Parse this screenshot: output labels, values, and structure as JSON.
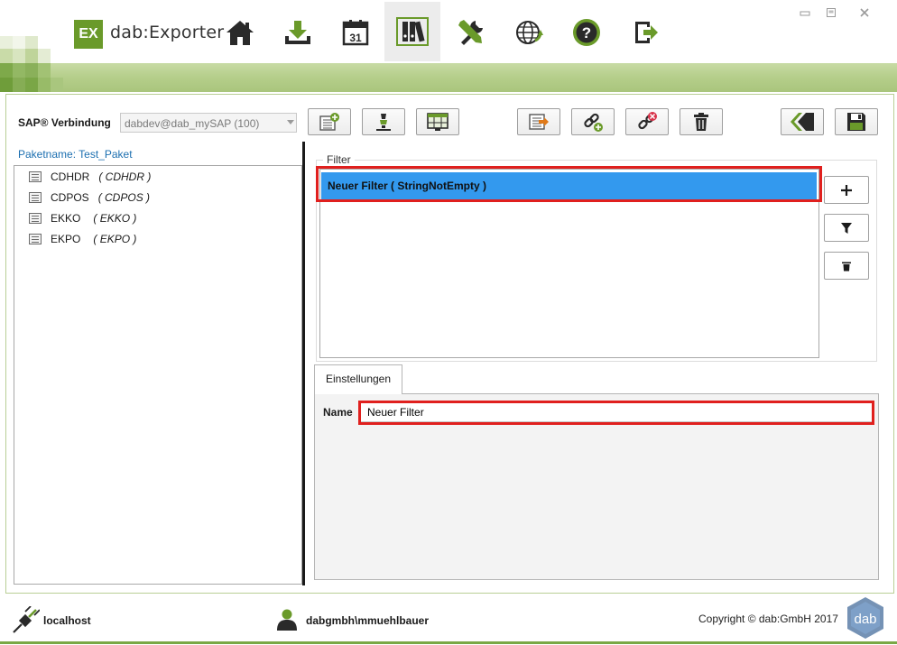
{
  "app": {
    "logo_mark": "EX",
    "logo_text": "dab:Exporter"
  },
  "nav": {
    "items": [
      {
        "name": "home",
        "icon": "home-icon",
        "active": false
      },
      {
        "name": "download",
        "icon": "download-icon",
        "active": false
      },
      {
        "name": "calendar",
        "icon": "calendar-icon",
        "calendar_day": "31",
        "active": false
      },
      {
        "name": "library",
        "icon": "binders-icon",
        "active": true
      },
      {
        "name": "tools",
        "icon": "tools-icon",
        "active": false
      },
      {
        "name": "network",
        "icon": "globe-icon",
        "active": false
      },
      {
        "name": "help",
        "icon": "help-icon",
        "active": false
      },
      {
        "name": "exit",
        "icon": "exit-icon",
        "active": false
      }
    ]
  },
  "window_controls": [
    "minimize",
    "restore",
    "close"
  ],
  "connection": {
    "label": "SAP® Verbindung",
    "value": "dabdev@dab_mySAP (100)"
  },
  "toolbar": {
    "buttons": [
      "add-table-icon",
      "lamp-icon",
      "table-view-icon",
      "export-icon",
      "link-add-icon",
      "link-remove-icon",
      "trash-icon",
      "back-icon",
      "save-icon"
    ]
  },
  "package": {
    "label": "Paketname: Test_Paket",
    "tables": [
      {
        "name": "CDHDR",
        "desc": "( CDHDR )"
      },
      {
        "name": "CDPOS",
        "desc": "( CDPOS )"
      },
      {
        "name": "EKKO",
        "desc": "( EKKO )"
      },
      {
        "name": "EKPO",
        "desc": "( EKPO )"
      }
    ]
  },
  "filter": {
    "group_label": "Filter",
    "items": [
      "Neuer Filter ( StringNotEmpty )"
    ],
    "side_buttons": [
      "plus-icon",
      "funnel-icon",
      "trash-icon"
    ]
  },
  "settings": {
    "tab_label": "Einstellungen",
    "name_label": "Name",
    "name_value": "Neuer Filter"
  },
  "status": {
    "host": "localhost",
    "user": "dabgmbh\\mmuehlbauer",
    "copyright": "Copyright © dab:GmbH 2017",
    "brand_badge": "dab"
  },
  "colors": {
    "accent_green": "#6a9a2a",
    "selection_blue": "#3399ee",
    "highlight_red": "#e0201e",
    "link_blue": "#1c6fb0"
  }
}
